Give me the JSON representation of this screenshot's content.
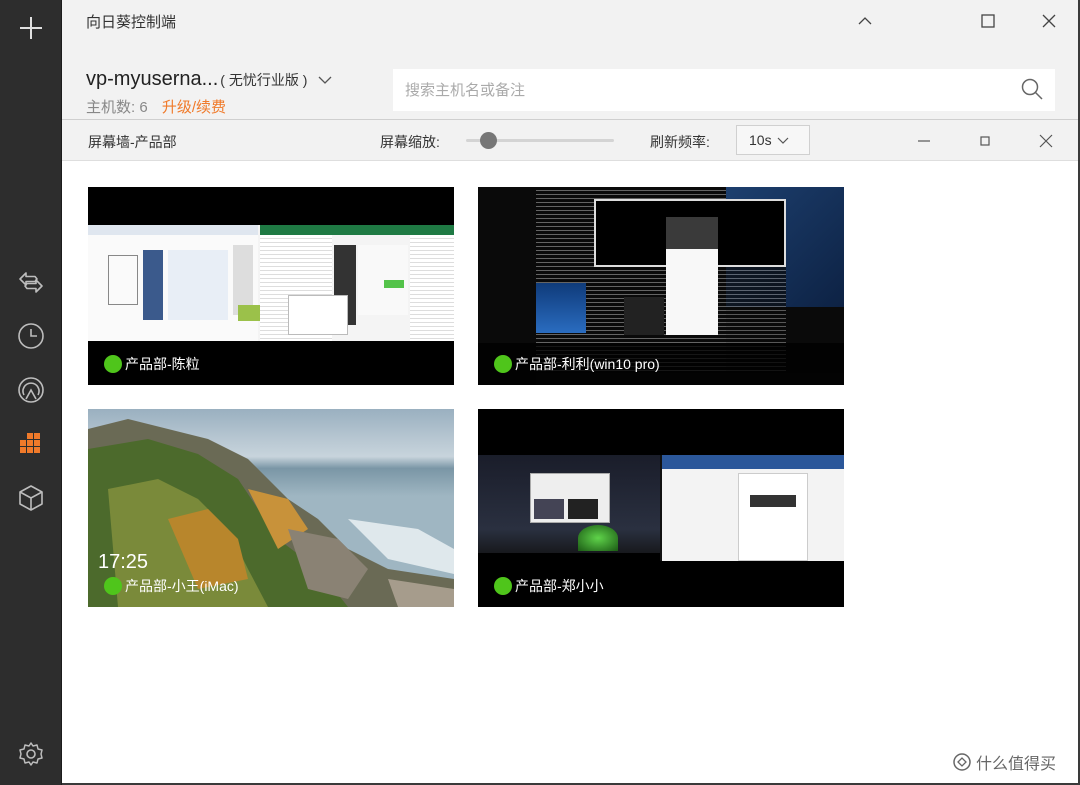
{
  "app": {
    "title": "向日葵控制端"
  },
  "account": {
    "name": "vp-myuserna...",
    "edition": "( 无忧行业版 )",
    "host_count_label": "主机数:",
    "host_count": "6",
    "upgrade_label": "升级/续费"
  },
  "search": {
    "placeholder": "搜索主机名或备注"
  },
  "wall": {
    "title": "屏幕墙-产品部",
    "zoom_label": "屏幕缩放:",
    "zoom_level": 0.15,
    "refresh_label": "刷新频率:",
    "refresh_value": "10s"
  },
  "hosts": [
    {
      "name": "产品部-陈粒",
      "status": "online"
    },
    {
      "name": "产品部-利利(win10 pro)",
      "status": "online"
    },
    {
      "name": "产品部-小王(iMac)",
      "status": "online",
      "clock": "17:25"
    },
    {
      "name": "产品部-郑小小",
      "status": "online"
    }
  ],
  "watermark": {
    "text": "什么值得买"
  },
  "colors": {
    "accent": "#f07a2a",
    "online": "#4fc51b",
    "sidebar": "#2d2d2d"
  },
  "sidebar_icons": [
    "plus-icon",
    "remote-control-icon",
    "history-icon",
    "discovery-icon",
    "screen-wall-icon",
    "plugin-box-icon",
    "settings-icon"
  ]
}
